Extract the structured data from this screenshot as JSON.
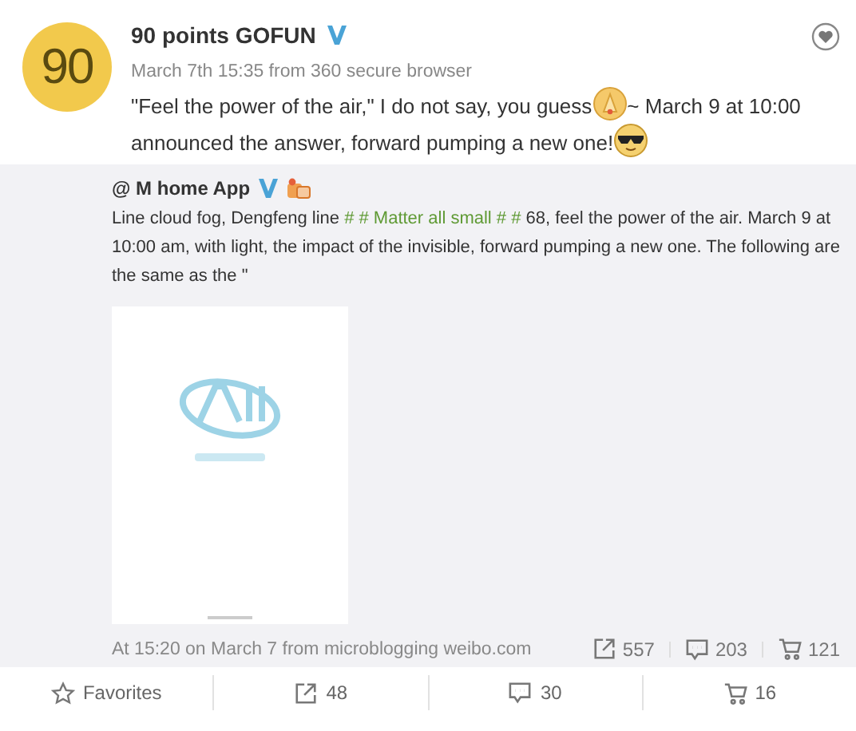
{
  "post": {
    "avatar_text": "90",
    "author": "90 points GOFUN",
    "verified": true,
    "meta": "March 7th 15:35 from 360 secure browser",
    "body": [
      {
        "kind": "text",
        "text": "\"Feel the power of the air,\" I do not say, you guess"
      },
      {
        "kind": "emoji"
      },
      {
        "kind": "text",
        "text": "~ March 9 at 10:00"
      },
      {
        "kind": "text",
        "text": "announced the answer, forward pumping a new one!"
      },
      {
        "kind": "emoji"
      }
    ]
  },
  "repost": {
    "author": "@ M home App",
    "verified": true,
    "badge": true,
    "body": [
      {
        "kind": "text",
        "text": "Line cloud fog, Dengfeng line"
      },
      {
        "kind": "topic",
        "text": "# # Matter all small # #"
      },
      {
        "kind": "text",
        "text": "68, feel the power of the air. March 9 at"
      },
      {
        "kind": "text",
        "text": "10:00 am, with light, the impact of the invisible, forward pumping a new one. The following are"
      },
      {
        "kind": "text",
        "text": "the same as the \""
      }
    ],
    "meta": "At 15:20 on March 7 from microblogging weibo.com",
    "stats": [
      {
        "kind": "share",
        "count": "557"
      },
      {
        "kind": "comment",
        "count": "203"
      },
      {
        "kind": "cart",
        "count": "121"
      }
    ]
  },
  "actions": [
    {
      "kind": "star",
      "label": "Favorites"
    },
    {
      "kind": "share",
      "label": "48"
    },
    {
      "kind": "comment",
      "label": "30"
    },
    {
      "kind": "cart",
      "label": "16"
    }
  ]
}
